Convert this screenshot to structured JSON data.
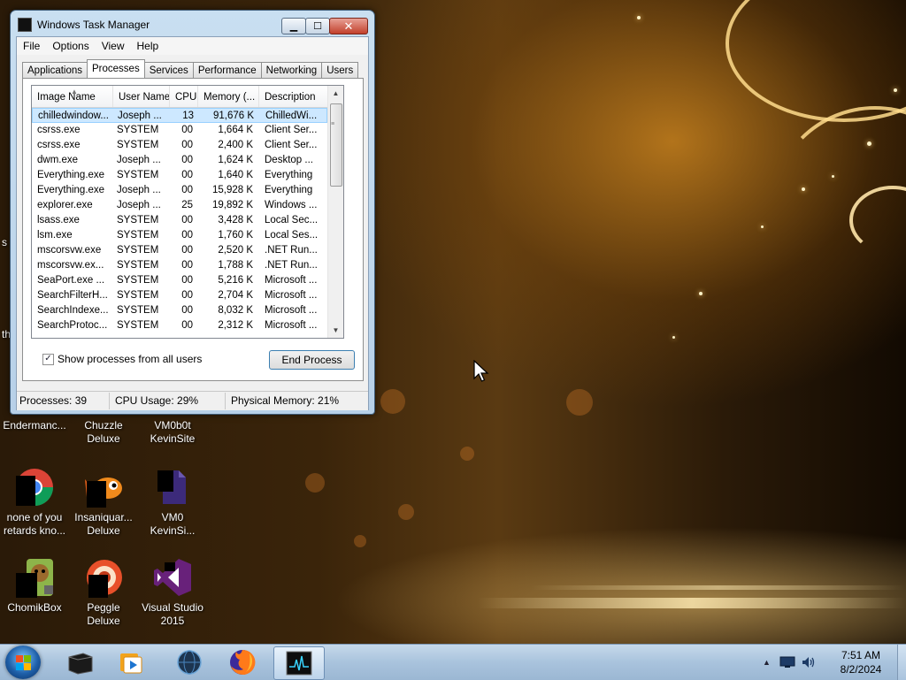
{
  "window": {
    "title": "Windows Task Manager",
    "menu": [
      "File",
      "Options",
      "View",
      "Help"
    ],
    "tabs": [
      "Applications",
      "Processes",
      "Services",
      "Performance",
      "Networking",
      "Users"
    ],
    "active_tab": "Processes",
    "columns": {
      "name": "Image Name",
      "user": "User Name",
      "cpu": "CPU",
      "mem": "Memory (...",
      "desc": "Description"
    },
    "rows": [
      {
        "name": "chilledwindow...",
        "user": "Joseph ...",
        "cpu": "13",
        "mem": "91,676 K",
        "desc": "ChilledWi..."
      },
      {
        "name": "csrss.exe",
        "user": "SYSTEM",
        "cpu": "00",
        "mem": "1,664 K",
        "desc": "Client Ser..."
      },
      {
        "name": "csrss.exe",
        "user": "SYSTEM",
        "cpu": "00",
        "mem": "2,400 K",
        "desc": "Client Ser..."
      },
      {
        "name": "dwm.exe",
        "user": "Joseph ...",
        "cpu": "00",
        "mem": "1,624 K",
        "desc": "Desktop ..."
      },
      {
        "name": "Everything.exe",
        "user": "SYSTEM",
        "cpu": "00",
        "mem": "1,640 K",
        "desc": "Everything"
      },
      {
        "name": "Everything.exe",
        "user": "Joseph ...",
        "cpu": "00",
        "mem": "15,928 K",
        "desc": "Everything"
      },
      {
        "name": "explorer.exe",
        "user": "Joseph ...",
        "cpu": "25",
        "mem": "19,892 K",
        "desc": "Windows ..."
      },
      {
        "name": "lsass.exe",
        "user": "SYSTEM",
        "cpu": "00",
        "mem": "3,428 K",
        "desc": "Local Sec..."
      },
      {
        "name": "lsm.exe",
        "user": "SYSTEM",
        "cpu": "00",
        "mem": "1,760 K",
        "desc": "Local Ses..."
      },
      {
        "name": "mscorsvw.exe",
        "user": "SYSTEM",
        "cpu": "00",
        "mem": "2,520 K",
        "desc": ".NET Run..."
      },
      {
        "name": "mscorsvw.ex...",
        "user": "SYSTEM",
        "cpu": "00",
        "mem": "1,788 K",
        "desc": ".NET Run..."
      },
      {
        "name": "SeaPort.exe ...",
        "user": "SYSTEM",
        "cpu": "00",
        "mem": "5,216 K",
        "desc": "Microsoft ..."
      },
      {
        "name": "SearchFilterH...",
        "user": "SYSTEM",
        "cpu": "00",
        "mem": "2,704 K",
        "desc": "Microsoft ..."
      },
      {
        "name": "SearchIndexe...",
        "user": "SYSTEM",
        "cpu": "00",
        "mem": "8,032 K",
        "desc": "Microsoft ..."
      },
      {
        "name": "SearchProtoc...",
        "user": "SYSTEM",
        "cpu": "00",
        "mem": "2,312 K",
        "desc": "Microsoft ..."
      }
    ],
    "selected_row": 0,
    "show_all_label": "Show processes from all users",
    "show_all_checked": true,
    "end_process_label": "End Process",
    "status": {
      "processes": "Processes: 39",
      "cpu": "CPU Usage: 29%",
      "memory": "Physical Memory: 21%"
    }
  },
  "desktop": {
    "clipped_text_left_1": "s",
    "clipped_text_left_2": "th",
    "icons": [
      {
        "label": "Endermanc...",
        "icon": "app-icon"
      },
      {
        "label": "Chuzzle Deluxe",
        "icon": "chuzzle-icon"
      },
      {
        "label": "VM0b0t KevinSite",
        "icon": "file-icon"
      },
      {
        "label": "none of you retards kno...",
        "icon": "chrome-icon"
      },
      {
        "label": "Insaniquar... Deluxe",
        "icon": "insaniquarium-icon"
      },
      {
        "label": "VM0 KevinSi...",
        "icon": "file-icon"
      },
      {
        "label": "ChomikBox",
        "icon": "chomikbox-icon"
      },
      {
        "label": "Peggle Deluxe",
        "icon": "peggle-icon"
      },
      {
        "label": "Visual Studio 2015",
        "icon": "visual-studio-icon"
      }
    ]
  },
  "taskbar": {
    "pinned": [
      {
        "name": "app-icon"
      },
      {
        "name": "media-player-icon"
      },
      {
        "name": "globe-app-icon"
      },
      {
        "name": "firefox-icon"
      },
      {
        "name": "task-manager-icon",
        "active": true
      }
    ],
    "clock_time": "7:51 AM",
    "clock_date": "8/2/2024"
  },
  "colors": {
    "selection": "#cde8ff",
    "window_frame": "#b7d0e8",
    "taskbar": "#a9c3dd"
  }
}
